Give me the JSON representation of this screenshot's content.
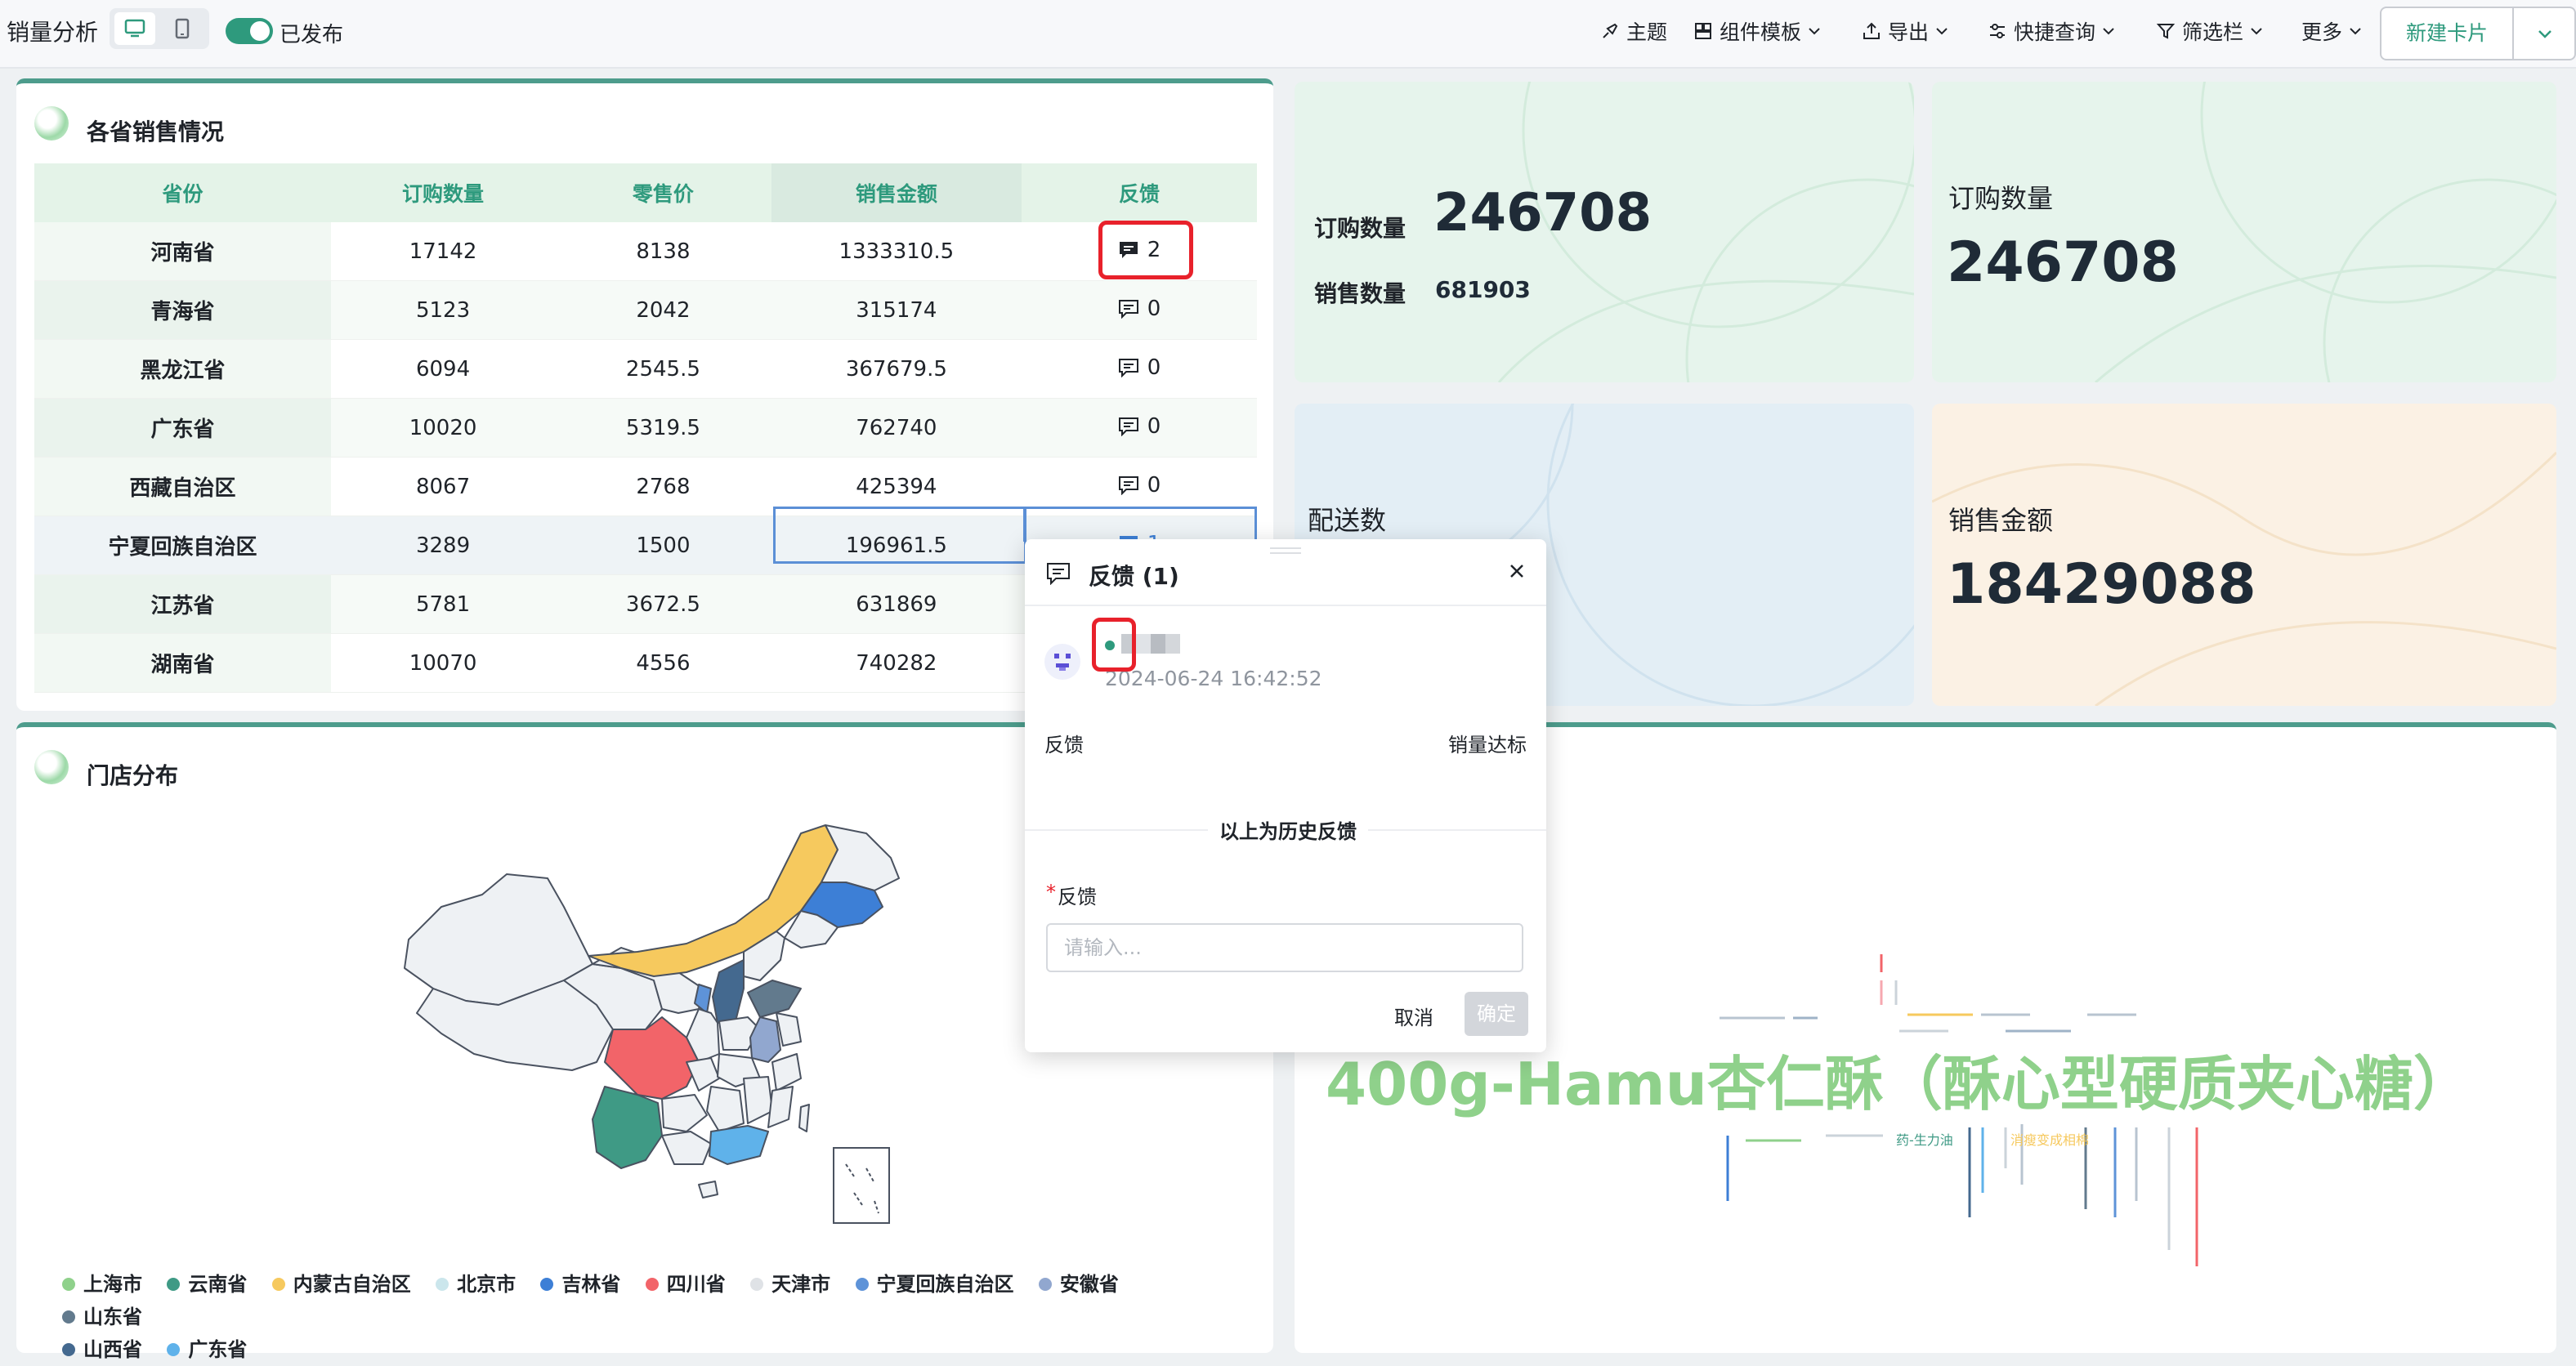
{
  "toolbar": {
    "title": "销量分析",
    "published_label": "已发布",
    "menus": [
      {
        "label": "主题",
        "icon": "brush-icon"
      },
      {
        "label": "组件模板",
        "icon": "template-icon"
      },
      {
        "label": "导出",
        "icon": "export-icon"
      },
      {
        "label": "快捷查询",
        "icon": "filter-sliders-icon"
      },
      {
        "label": "筛选栏",
        "icon": "funnel-icon"
      },
      {
        "label": "更多",
        "icon": ""
      }
    ],
    "new_card_label": "新建卡片"
  },
  "sales_table": {
    "title": "各省销售情况",
    "columns": [
      "省份",
      "订购数量",
      "零售价",
      "销售金额",
      "反馈"
    ],
    "rows": [
      [
        "河南省",
        "17142",
        "8138",
        "1333310.5",
        "2"
      ],
      [
        "青海省",
        "5123",
        "2042",
        "315174",
        "0"
      ],
      [
        "黑龙江省",
        "6094",
        "2545.5",
        "367679.5",
        "0"
      ],
      [
        "广东省",
        "10020",
        "5319.5",
        "762740",
        "0"
      ],
      [
        "西藏自治区",
        "8067",
        "2768",
        "425394",
        "0"
      ],
      [
        "宁夏回族自治区",
        "3289",
        "1500",
        "196961.5",
        "1"
      ],
      [
        "江苏省",
        "5781",
        "3672.5",
        "631869",
        ""
      ],
      [
        "湖南省",
        "10070",
        "4556",
        "740282",
        ""
      ]
    ]
  },
  "metrics": {
    "card1": {
      "label1": "订购数量",
      "value1": "246708",
      "label2": "销售数量",
      "value2": "681903"
    },
    "card2": {
      "label": "订购数量",
      "value": "246708"
    },
    "card3": {
      "label": "配送数"
    },
    "card4": {
      "label": "销售金额",
      "value": "18429088"
    }
  },
  "store_map": {
    "title": "门店分布",
    "legend": [
      {
        "label": "上海市",
        "color": "#8fd18b"
      },
      {
        "label": "云南省",
        "color": "#3f9a85"
      },
      {
        "label": "内蒙古自治区",
        "color": "#f6c95e"
      },
      {
        "label": "北京市",
        "color": "#cbe6ec"
      },
      {
        "label": "吉林省",
        "color": "#3d7fd6"
      },
      {
        "label": "四川省",
        "color": "#f26469"
      },
      {
        "label": "天津市",
        "color": "#dfe2e6"
      },
      {
        "label": "宁夏回族自治区",
        "color": "#5e93d8"
      },
      {
        "label": "安徽省",
        "color": "#91a7cf"
      },
      {
        "label": "山东省",
        "color": "#627a8d"
      },
      {
        "label": "山西省",
        "color": "#44698f"
      },
      {
        "label": "广东省",
        "color": "#5fb2ea"
      }
    ]
  },
  "word_cloud": {
    "main_word": "400g-Hamu杏仁酥（酥心型硬质夹心糖）",
    "small_words": [
      "药-生力油",
      "消瘦变成相棉"
    ]
  },
  "feedback_popup": {
    "title": "反馈 (1)",
    "timestamp": "2024-06-24 16:42:52",
    "feedback_label": "反馈",
    "feedback_value": "销量达标",
    "history_note": "以上为历史反馈",
    "required_mark": "*",
    "form_label": "反馈",
    "input_placeholder": "请输入...",
    "cancel_label": "取消",
    "ok_label": "确定"
  }
}
